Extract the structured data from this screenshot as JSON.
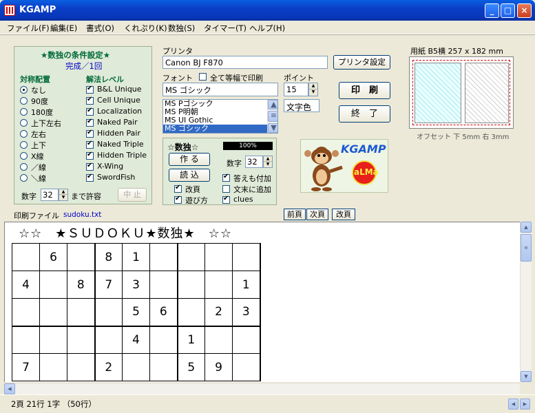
{
  "window": {
    "title": "KGAMP"
  },
  "menu": [
    {
      "label": "ファイル(F)"
    },
    {
      "label": "編集(E)"
    },
    {
      "label": "書式(O)"
    },
    {
      "label": "くれぷり(K)"
    },
    {
      "label": "数独(S)"
    },
    {
      "label": "タイマー(T)"
    },
    {
      "label": "ヘルプ(H)"
    }
  ],
  "conditions": {
    "title": "★数独の条件設定★",
    "subtitle": "完成／1回",
    "symmetry_label": "対称配置",
    "methods_label": "解法レベル",
    "symmetry": [
      {
        "label": "なし",
        "selected": true
      },
      {
        "label": "90度",
        "selected": false
      },
      {
        "label": "180度",
        "selected": false
      },
      {
        "label": "上下左右",
        "selected": false
      },
      {
        "label": "左右",
        "selected": false
      },
      {
        "label": "上下",
        "selected": false
      },
      {
        "label": "X線",
        "selected": false
      },
      {
        "label": "／線",
        "selected": false
      },
      {
        "label": "＼線",
        "selected": false
      }
    ],
    "methods": [
      {
        "label": "B&L Unique",
        "checked": true
      },
      {
        "label": "Cell Unique",
        "checked": true
      },
      {
        "label": "Localization",
        "checked": true
      },
      {
        "label": "Naked Pair",
        "checked": true
      },
      {
        "label": "Hidden Pair",
        "checked": true
      },
      {
        "label": "Naked Triple",
        "checked": true
      },
      {
        "label": "Hidden Triple",
        "checked": true
      },
      {
        "label": "X-Wing",
        "checked": true
      },
      {
        "label": "SwordFish",
        "checked": true
      }
    ],
    "count_label": "数字",
    "count_value": "32",
    "count_suffix": "まで許容",
    "stop_button": "中 止"
  },
  "printer": {
    "label": "プリンタ",
    "value": "Canon BJ F870",
    "settings_button": "プリンタ設定",
    "font_label": "フォント",
    "monospace_label": "全て等幅で印刷",
    "point_label": "ポイント",
    "font_value": "MS ゴシック",
    "point_value": "15",
    "font_list": [
      "MS Pゴシック",
      "MS P明朝",
      "MS UI Gothic",
      "MS ゴシック"
    ],
    "font_color_button": "文字色",
    "print_button": "印　刷",
    "exit_button": "終　了"
  },
  "paper": {
    "label": "用紙 B5横 257 x 182 mm",
    "offset": "オフセット 下 5mm  右 3mm"
  },
  "sudoku_panel": {
    "title": "☆数独☆",
    "progress": "100%",
    "progress_value": 1.0,
    "make_button": "作 る",
    "load_button": "読 込",
    "count_label": "数字",
    "count_value": "32",
    "options": [
      {
        "label": "改頁",
        "checked": true
      },
      {
        "label": "遊び方",
        "checked": true
      },
      {
        "label": "答えも付加",
        "checked": true
      },
      {
        "label": "文末に追加",
        "checked": false
      },
      {
        "label": "clues",
        "checked": true
      }
    ]
  },
  "logo": {
    "title": "KGAMP",
    "badge": "aLMa"
  },
  "file": {
    "label": "印刷ファイル",
    "name": "sudoku.txt"
  },
  "page_buttons": [
    "前頁",
    "次頁",
    "改頁"
  ],
  "document": {
    "heading": "☆☆　★ＳＵＤＯＫＵ★数独★　☆☆",
    "rows": [
      [
        "",
        "6",
        "",
        "8",
        "1",
        "",
        "",
        "",
        ""
      ],
      [
        "4",
        "",
        "8",
        "7",
        "3",
        "",
        "",
        "",
        "1"
      ],
      [
        "",
        "",
        "",
        "",
        "5",
        "6",
        "",
        "2",
        "3"
      ],
      [
        "",
        "",
        "",
        "",
        "4",
        "",
        "1",
        "",
        ""
      ],
      [
        "7",
        "",
        "",
        "2",
        "",
        "",
        "5",
        "9",
        ""
      ]
    ]
  },
  "status": {
    "text": "2頁 21行 1字 （50行）"
  }
}
